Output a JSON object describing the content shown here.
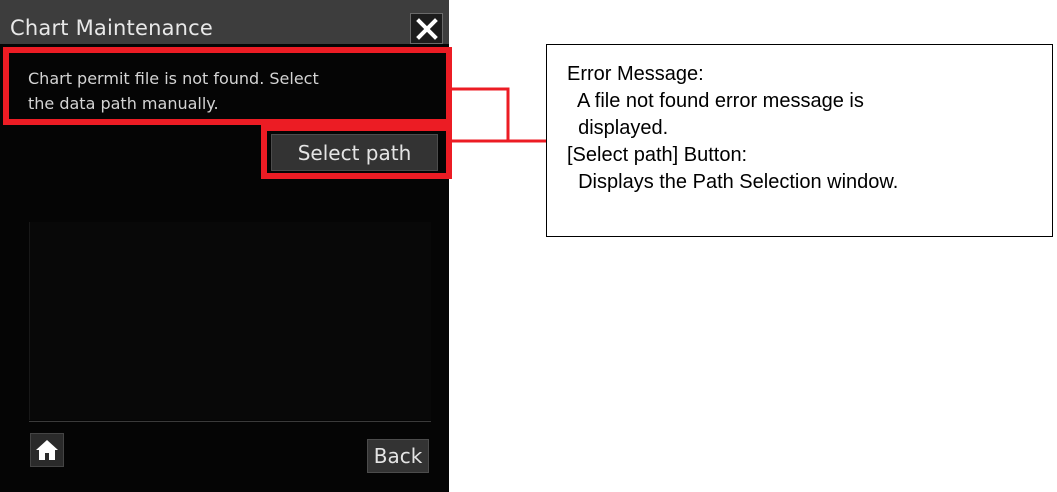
{
  "window": {
    "title": "Chart Maintenance",
    "close_icon": "close-icon"
  },
  "message": {
    "line1": "Chart permit file is not found. Select",
    "line2": "the data path manually."
  },
  "buttons": {
    "select_path": "Select path",
    "back": "Back",
    "home_icon": "home-icon"
  },
  "annotation": {
    "lines": [
      "Error Message:",
      "  A file not found error message is",
      "  displayed.",
      "[Select path] Button:",
      "  Displays the Path Selection window."
    ],
    "highlight_color": "#ec1c24"
  },
  "colors": {
    "panel_bg": "#050505",
    "titlebar_bg": "#3d3d3d",
    "button_bg": "#333333"
  }
}
